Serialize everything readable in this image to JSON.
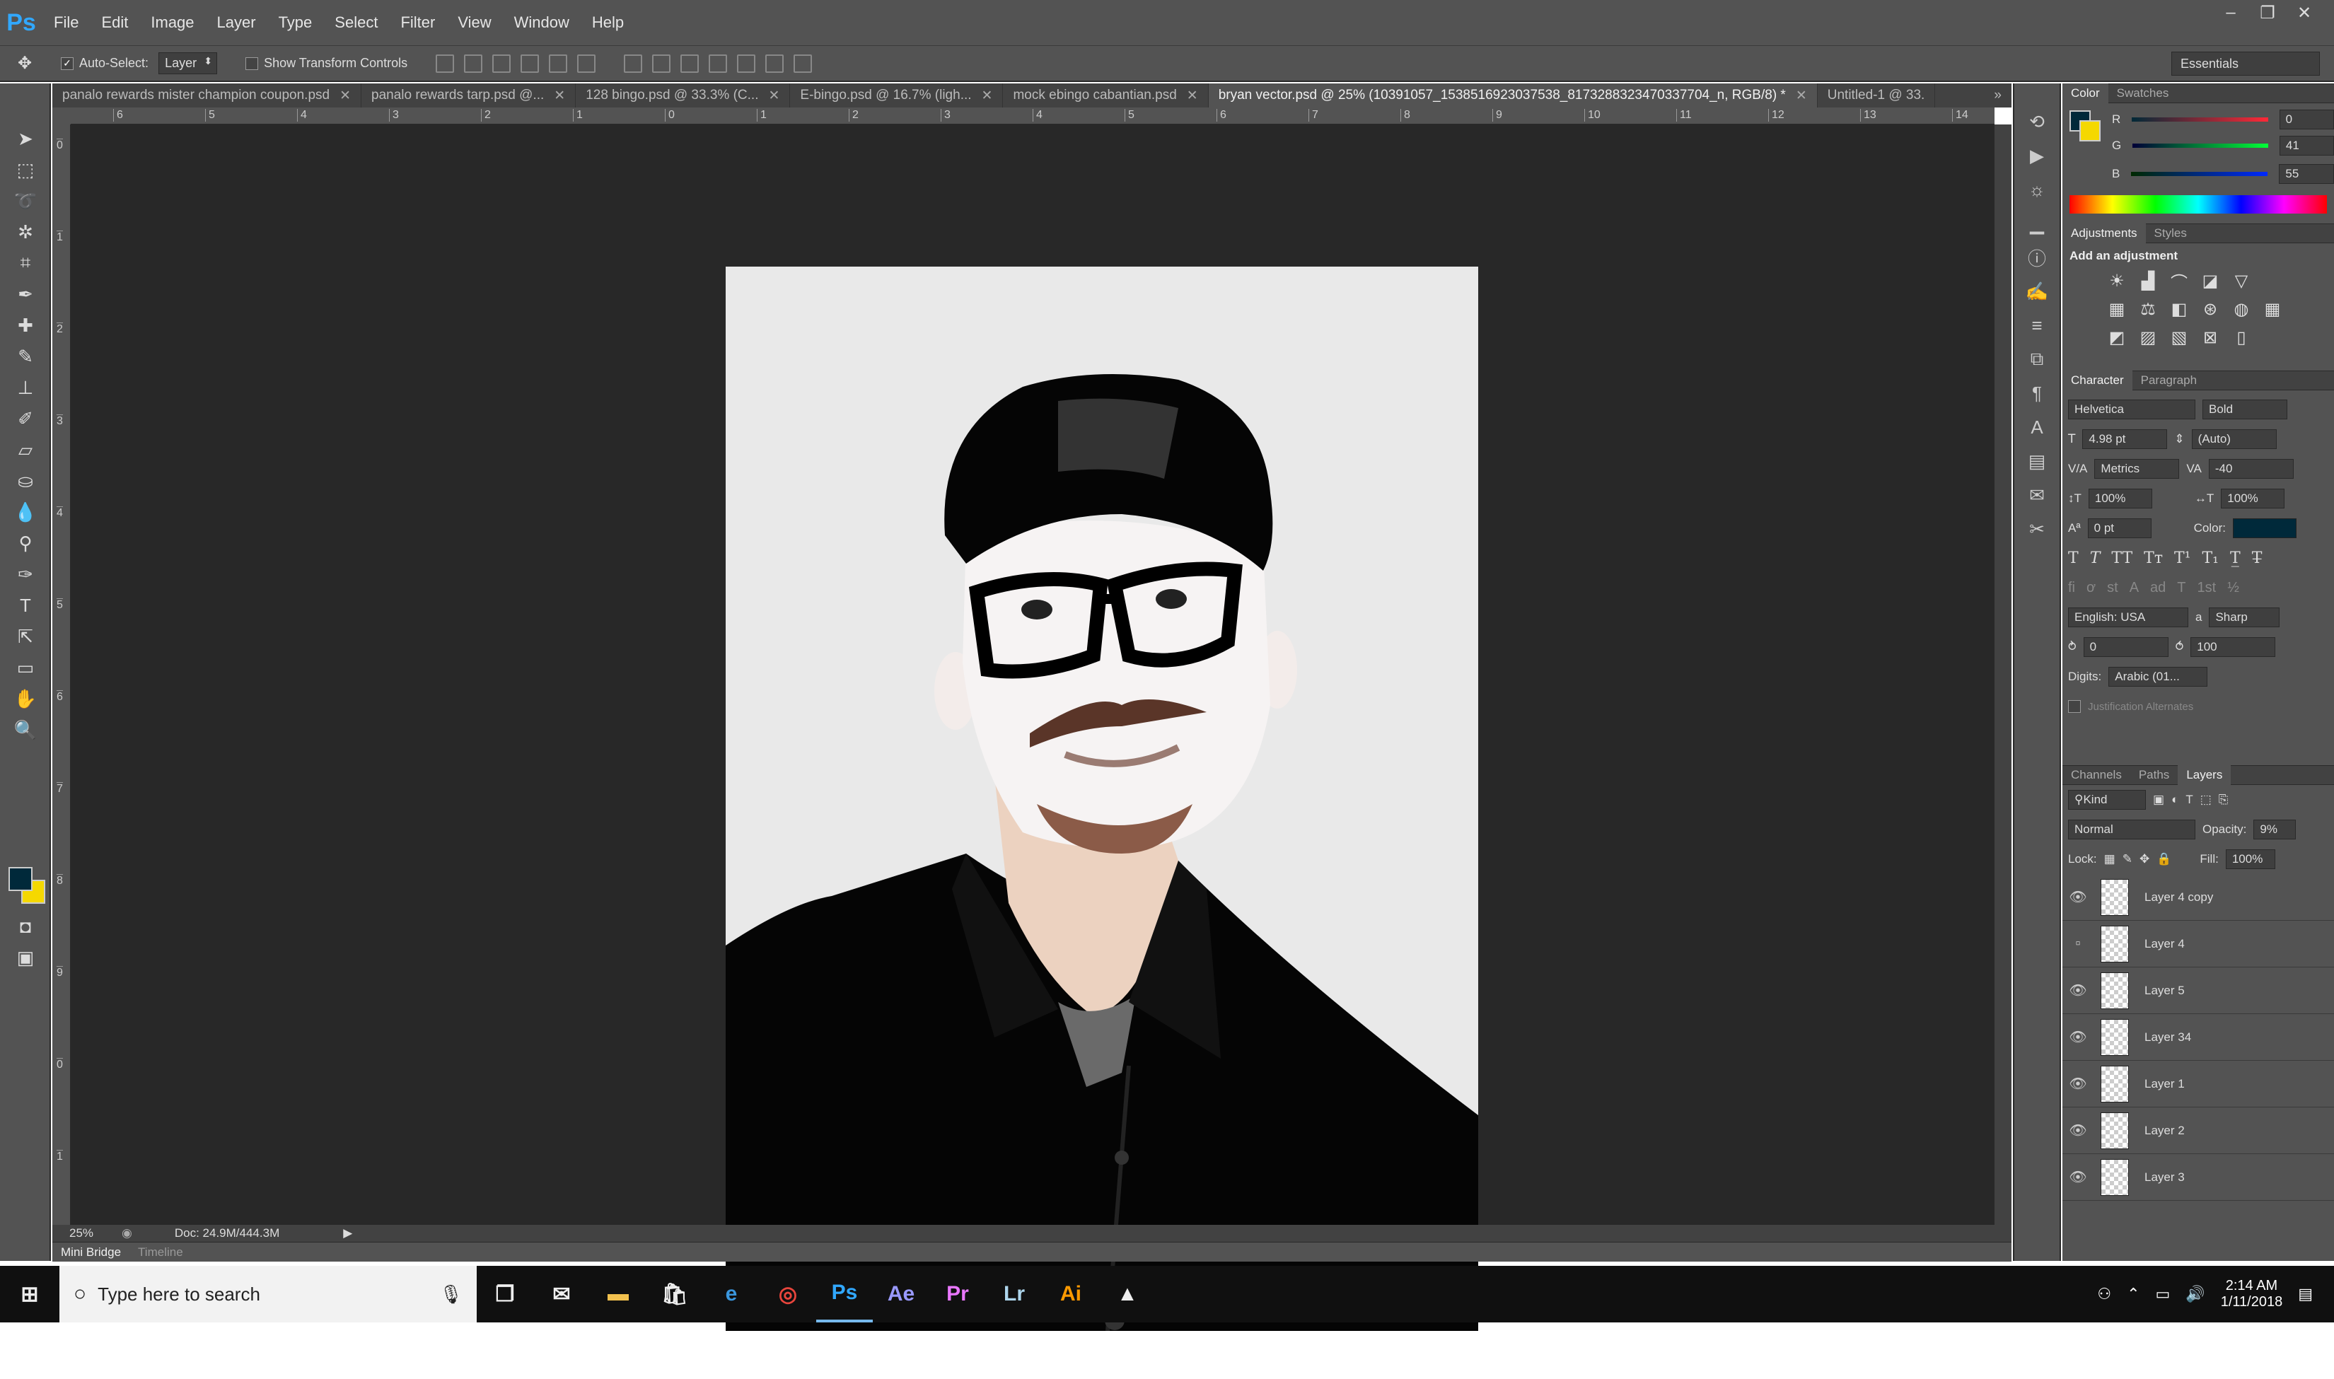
{
  "app": {
    "logo": "Ps"
  },
  "menu": [
    "File",
    "Edit",
    "Image",
    "Layer",
    "Type",
    "Select",
    "Filter",
    "View",
    "Window",
    "Help"
  ],
  "window_controls": [
    "–",
    "❐",
    "✕"
  ],
  "options": {
    "auto_select_label": "Auto-Select:",
    "auto_select_value": "Layer",
    "transform_label": "Show Transform Controls",
    "workspace": "Essentials"
  },
  "tabs": [
    {
      "label": "panalo rewards mister champion coupon.psd"
    },
    {
      "label": "panalo rewards tarp.psd @..."
    },
    {
      "label": "128 bingo.psd @ 33.3% (C..."
    },
    {
      "label": "E-bingo.psd @ 16.7% (ligh..."
    },
    {
      "label": "mock ebingo cabantian.psd"
    },
    {
      "label": "bryan vector.psd @ 25% (10391057_1538516923037538_8173288323470337704_n, RGB/8) *"
    },
    {
      "label": "Untitled-1 @ 33."
    }
  ],
  "ruler_h": [
    "6",
    "5",
    "4",
    "3",
    "2",
    "1",
    "0",
    "1",
    "2",
    "3",
    "4",
    "5",
    "6",
    "7",
    "8",
    "9",
    "10",
    "11",
    "12",
    "13",
    "14"
  ],
  "ruler_v": [
    "0",
    "1",
    "2",
    "3",
    "4",
    "5",
    "6",
    "7",
    "8",
    "9",
    "0",
    "1"
  ],
  "status": {
    "zoom": "25%",
    "doc": "Doc: 24.9M/444.3M"
  },
  "bottom_tabs": [
    "Mini Bridge",
    "Timeline"
  ],
  "color_panel": {
    "tabs": [
      "Color",
      "Swatches"
    ],
    "r_label": "R",
    "r": "0",
    "g_label": "G",
    "g": "41",
    "b_label": "B",
    "b": "55",
    "fg": "#00293a",
    "bg": "#f5d800"
  },
  "adjustments": {
    "tabs": [
      "Adjustments",
      "Styles"
    ],
    "title": "Add an adjustment"
  },
  "character": {
    "tabs": [
      "Character",
      "Paragraph"
    ],
    "font": "Helvetica",
    "style": "Bold",
    "size": "4.98 pt",
    "leading": "(Auto)",
    "kerning": "Metrics",
    "tracking": "-40",
    "vscale": "100%",
    "hscale": "100%",
    "baseline": "0 pt",
    "color_label": "Color:",
    "language": "English: USA",
    "aa_label": "a",
    "aa": "Sharp",
    "indent": "0",
    "indent2": "100",
    "digits_label": "Digits:",
    "digits": "Arabic (01...",
    "justification": "Justification Alternates"
  },
  "layers_panel": {
    "tabs": [
      "Channels",
      "Paths",
      "Layers"
    ],
    "kind": "Kind",
    "blend": "Normal",
    "opacity_label": "Opacity:",
    "opacity": "9%",
    "lock_label": "Lock:",
    "fill_label": "Fill:",
    "fill": "100%",
    "layers": [
      {
        "name": "Layer 4 copy",
        "visible": true
      },
      {
        "name": "Layer 4",
        "visible": false
      },
      {
        "name": "Layer 5",
        "visible": true
      },
      {
        "name": "Layer 34",
        "visible": true
      },
      {
        "name": "Layer 1",
        "visible": true
      },
      {
        "name": "Layer 2",
        "visible": true
      },
      {
        "name": "Layer 3",
        "visible": true
      }
    ]
  },
  "taskbar": {
    "search_placeholder": "Type here to search",
    "apps": [
      "Ps",
      "Ae",
      "Pr",
      "Lr",
      "Ai"
    ],
    "time": "2:14 AM",
    "date": "1/11/2018"
  }
}
